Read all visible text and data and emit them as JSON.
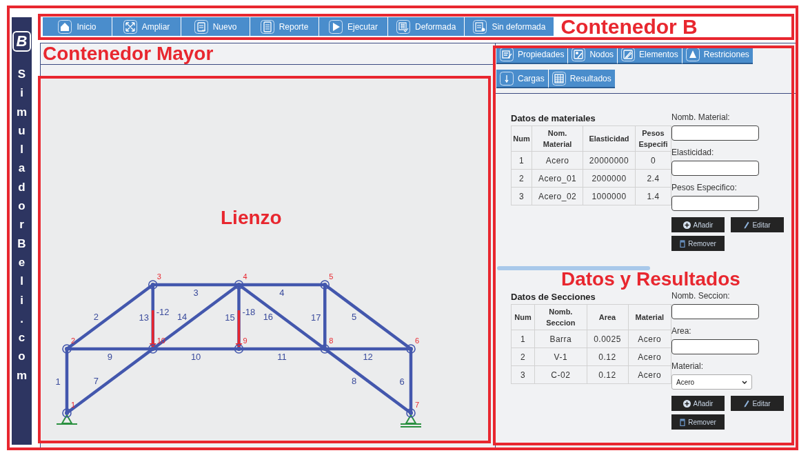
{
  "sidebar": {
    "logo": "B",
    "brand": "SimuladorBeli.com"
  },
  "toolbar": {
    "buttons": [
      {
        "label": "Inicio",
        "kind": "home"
      },
      {
        "label": "Ampliar",
        "kind": "expand"
      },
      {
        "label": "Nuevo",
        "kind": "new"
      },
      {
        "label": "Reporte",
        "kind": "report"
      },
      {
        "label": "Ejecutar",
        "kind": "play"
      },
      {
        "label": "Deformada",
        "kind": "deformed"
      },
      {
        "label": "Sin deformada",
        "kind": "undeformed"
      }
    ],
    "annotation": "Contenedor B"
  },
  "main": {
    "annotation": "Contenedor Mayor"
  },
  "canvas": {
    "annotation": "Lienzo",
    "nodes": [
      {
        "label": "3",
        "kind": "free"
      },
      {
        "label": "4",
        "kind": "free"
      },
      {
        "label": "5",
        "kind": "free"
      },
      {
        "label": "2",
        "kind": "free"
      },
      {
        "label": "10",
        "kind": "free",
        "load": "-12"
      },
      {
        "label": "9",
        "kind": "free",
        "load": "-18"
      },
      {
        "label": "8",
        "kind": "free"
      },
      {
        "label": "6",
        "kind": "free"
      },
      {
        "label": "1",
        "kind": "pin"
      },
      {
        "label": "7",
        "kind": "roller"
      }
    ],
    "elements": [
      {
        "label": "3"
      },
      {
        "label": "4"
      },
      {
        "label": "2"
      },
      {
        "label": "13"
      },
      {
        "label": "14"
      },
      {
        "label": "15"
      },
      {
        "label": "16"
      },
      {
        "label": "17"
      },
      {
        "label": "5"
      },
      {
        "label": "9"
      },
      {
        "label": "10"
      },
      {
        "label": "11"
      },
      {
        "label": "12"
      },
      {
        "label": "1"
      },
      {
        "label": "7"
      },
      {
        "label": "8"
      },
      {
        "label": "6"
      }
    ]
  },
  "panel": {
    "annotation": "Datos y Resultados",
    "tabs": [
      {
        "label": "Propiedades",
        "kind": "properties"
      },
      {
        "label": "Nodos",
        "kind": "nodes"
      },
      {
        "label": "Elementos",
        "kind": "elements"
      },
      {
        "label": "Restriciones",
        "kind": "restraints"
      },
      {
        "label": "Cargas",
        "kind": "loads"
      },
      {
        "label": "Resultados",
        "kind": "results"
      }
    ],
    "materials": {
      "title": "Datos de materiales",
      "columns": [
        "Num",
        "Nom. Material",
        "Elasticidad",
        "Pesos Especifi"
      ],
      "rows": [
        [
          "1",
          "Acero",
          "20000000",
          "0"
        ],
        [
          "2",
          "Acero_01",
          "2000000",
          "2.4"
        ],
        [
          "3",
          "Acero_02",
          "1000000",
          "1.4"
        ]
      ]
    },
    "material_form": {
      "fields": [
        {
          "label": "Nomb. Material:",
          "kind": "text"
        },
        {
          "label": "Elasticidad:",
          "kind": "text"
        },
        {
          "label": "Pesos Especifico:",
          "kind": "text"
        }
      ],
      "buttons": [
        {
          "label": "Añadir",
          "kind": "add"
        },
        {
          "label": "Editar",
          "kind": "edit"
        },
        {
          "label": "Remover",
          "kind": "remove"
        }
      ]
    },
    "sections": {
      "title": "Datos de Secciones",
      "columns": [
        "Num",
        "Nomb. Seccion",
        "Area",
        "Material"
      ],
      "rows": [
        [
          "1",
          "Barra",
          "0.0025",
          "Acero"
        ],
        [
          "2",
          "V-1",
          "0.12",
          "Acero"
        ],
        [
          "3",
          "C-02",
          "0.12",
          "Acero"
        ]
      ]
    },
    "section_form": {
      "fields": [
        {
          "label": "Nomb. Seccion:",
          "kind": "text"
        },
        {
          "label": "Area:",
          "kind": "text"
        },
        {
          "label": "Material:",
          "kind": "select",
          "value": "Acero"
        }
      ],
      "buttons": [
        {
          "label": "Añadir",
          "kind": "add"
        },
        {
          "label": "Editar",
          "kind": "edit"
        },
        {
          "label": "Remover",
          "kind": "remove"
        }
      ]
    }
  }
}
